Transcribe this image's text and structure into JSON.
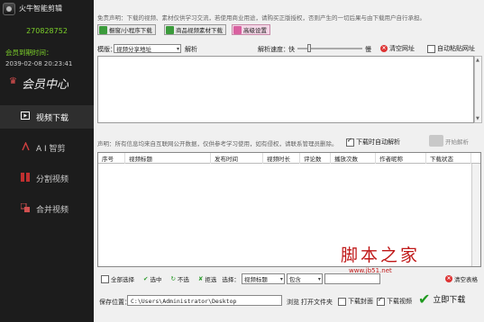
{
  "sidebar": {
    "app_title": "火牛智能剪辑",
    "user_id": "270828752",
    "expire_label": "会员到期时间：",
    "expire_date": "2039-02-08 20:23:41",
    "vip_center": "会员中心",
    "nav": [
      {
        "label": "视频下载",
        "icon": "video-icon",
        "active": true
      },
      {
        "label": "A I 智剪",
        "icon": "ai-icon",
        "active": false
      },
      {
        "label": "分割视频",
        "icon": "split-icon",
        "active": false
      },
      {
        "label": "合并视频",
        "icon": "merge-icon",
        "active": false
      }
    ]
  },
  "top": {
    "notice": "免责声明：下载的视频、素材仅供学习交流，若使用商业用途，请购买正版授权，否则产生的一切后果与由下载用户自行承担。",
    "buttons": [
      "橱窗/小程序下载",
      "商品视频素材下载",
      "高级设置"
    ],
    "mode_label": "模版：",
    "mode_value": "视频分享地址",
    "parse_label": "解析",
    "speed_label": "解析速度：",
    "speed_fast": "快",
    "speed_slow": "慢",
    "speed_level": 0.18,
    "clear_url": "清空网址",
    "auto_paste": "自动粘贴网址"
  },
  "parse_notice": "声明：所有信息均来自互联网公开数据，仅供参考学习使用，如有侵权，请联系管理员删除。",
  "auto_parse": "下载时自动解析",
  "start_parse": "开始解析",
  "table": {
    "columns": [
      "序号",
      "视频标题",
      "发布时间",
      "视频时长",
      "评论数",
      "播放次数",
      "作者昵称",
      "下载状态"
    ]
  },
  "actions": {
    "select_all": "全部选择",
    "select": "选中",
    "unselect": "不选",
    "filter": "拒选",
    "choose_label": "选择：",
    "field": "视频标题",
    "op": "包含",
    "clear_table": "清空表格"
  },
  "save": {
    "label": "保存位置：",
    "path": "C:\\Users\\Administrator\\Desktop",
    "browse": "浏览",
    "open_folder": "打开文件夹",
    "download_cover": "下载封面",
    "download_video": "下载视频",
    "download_now": "立即下载"
  },
  "watermark": {
    "text": "脚本之家",
    "url": "www.jb51.net"
  }
}
